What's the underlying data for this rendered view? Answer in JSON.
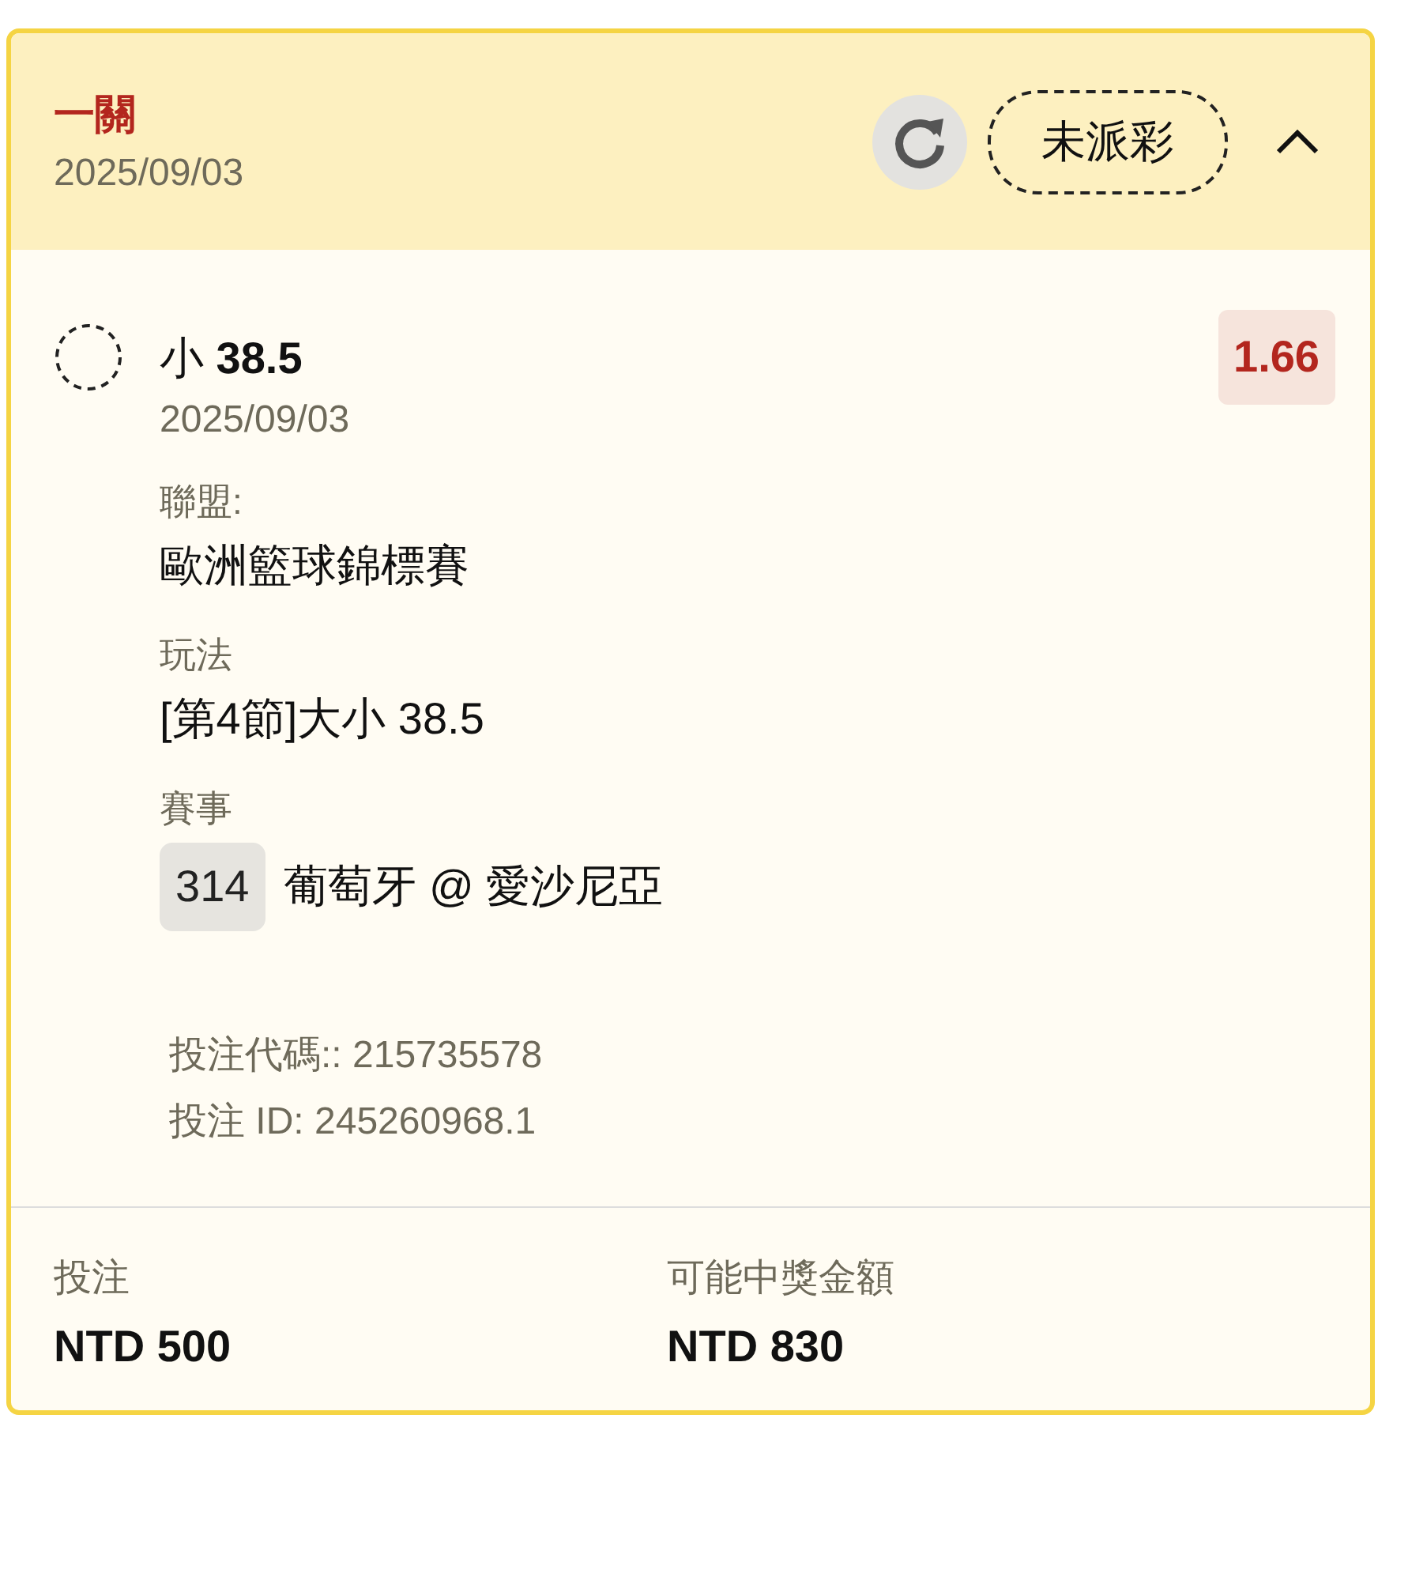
{
  "header": {
    "title": "一關",
    "date": "2025/09/03",
    "status": "未派彩",
    "expanded": true
  },
  "selection": {
    "pick": "小 **38.5**",
    "date": "2025/09/03",
    "odds": "1.66",
    "details": [
      {
        "kind": "text",
        "label": "聯盟:",
        "value": "歐洲籃球錦標賽"
      },
      {
        "kind": "text",
        "label": "玩法",
        "value": "[第4節]大小 38.5"
      },
      {
        "kind": "match",
        "label": "賽事",
        "number": "314",
        "value": "葡萄牙 @ 愛沙尼亞"
      }
    ],
    "codes": [
      "投注代碼:: 215735578",
      "投注 ID: 245260968.1"
    ]
  },
  "footer": [
    {
      "label": "投注",
      "value": "NTD 500"
    },
    {
      "label": "可能中獎金額",
      "value": "NTD 830"
    }
  ]
}
